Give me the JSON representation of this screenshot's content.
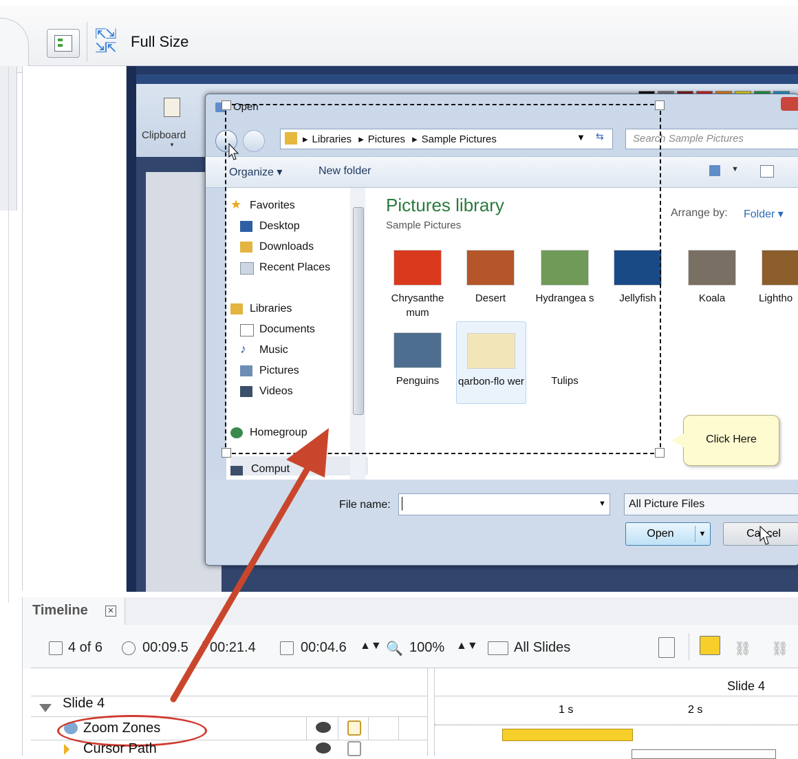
{
  "toolbar": {
    "full_size_label": "Full Size",
    "icon_props": "properties-panel-icon",
    "icon_fullsize": "full-size-icon"
  },
  "paint": {
    "clipboard_label": "Clipboard"
  },
  "dialog": {
    "title": "Open",
    "address": [
      "Libraries",
      "Pictures",
      "Sample Pictures"
    ],
    "search_placeholder": "Search Sample Pictures",
    "organize_label": "Organize ▾",
    "new_folder_label": "New folder",
    "nav_items": [
      {
        "label": "Favorites",
        "icon": "star-icon"
      },
      {
        "label": "Desktop",
        "icon": "desktop-icon"
      },
      {
        "label": "Downloads",
        "icon": "downloads-icon"
      },
      {
        "label": "Recent Places",
        "icon": "recent-places-icon"
      },
      {
        "label": "Libraries",
        "icon": "libraries-icon"
      },
      {
        "label": "Documents",
        "icon": "documents-icon"
      },
      {
        "label": "Music",
        "icon": "music-icon"
      },
      {
        "label": "Pictures",
        "icon": "pictures-icon"
      },
      {
        "label": "Videos",
        "icon": "videos-icon"
      },
      {
        "label": "Homegroup",
        "icon": "homegroup-icon"
      },
      {
        "label": "Comput",
        "icon": "computer-icon"
      }
    ],
    "library_title": "Pictures library",
    "library_subtitle": "Sample Pictures",
    "arrange_by_label": "Arrange by:",
    "arrange_by_value": "Folder ▾",
    "thumbnails": [
      {
        "label": "Chrysanthe mum",
        "color": "#d9391c"
      },
      {
        "label": "Desert",
        "color": "#b4562a"
      },
      {
        "label": "Hydrangea s",
        "color": "#6f9a58"
      },
      {
        "label": "Jellyfish",
        "color": "#1a4a86"
      },
      {
        "label": "Koala",
        "color": "#7a6f63"
      },
      {
        "label": "Lightho",
        "color": "#8b5e2b"
      },
      {
        "label": "Penguins",
        "color": "#4d6e8e"
      },
      {
        "label": "qarbon-flo wer",
        "color": "#f2e6b8"
      },
      {
        "label": "Tulips",
        "color": "#d8c23a"
      }
    ],
    "callout_text": "Click Here",
    "file_name_label": "File name:",
    "file_name_value": "",
    "filter_value": "All Picture Files",
    "open_label": "Open",
    "cancel_label": "Cancel"
  },
  "timeline": {
    "title": "Timeline",
    "slide_count": "4 of 6",
    "current_time": "00:09.5",
    "total_time": "00:21.4",
    "duration": "00:04.6",
    "zoom": "100%",
    "all_slides_label": "All Slides",
    "group_label": "Slide 4",
    "ruler_slide_label": "Slide 4",
    "ruler_marks": [
      "1 s",
      "2 s"
    ],
    "rows": [
      {
        "label": "Zoom Zones",
        "icon": "zoom-zones-icon"
      },
      {
        "label": "Cursor Path",
        "icon": "cursor-path-icon"
      }
    ],
    "zoom_zone_bar_color": "#f7cf2a"
  },
  "annotation": {
    "arrow_color": "#c9462d",
    "circle_color": "#d03a2f"
  }
}
